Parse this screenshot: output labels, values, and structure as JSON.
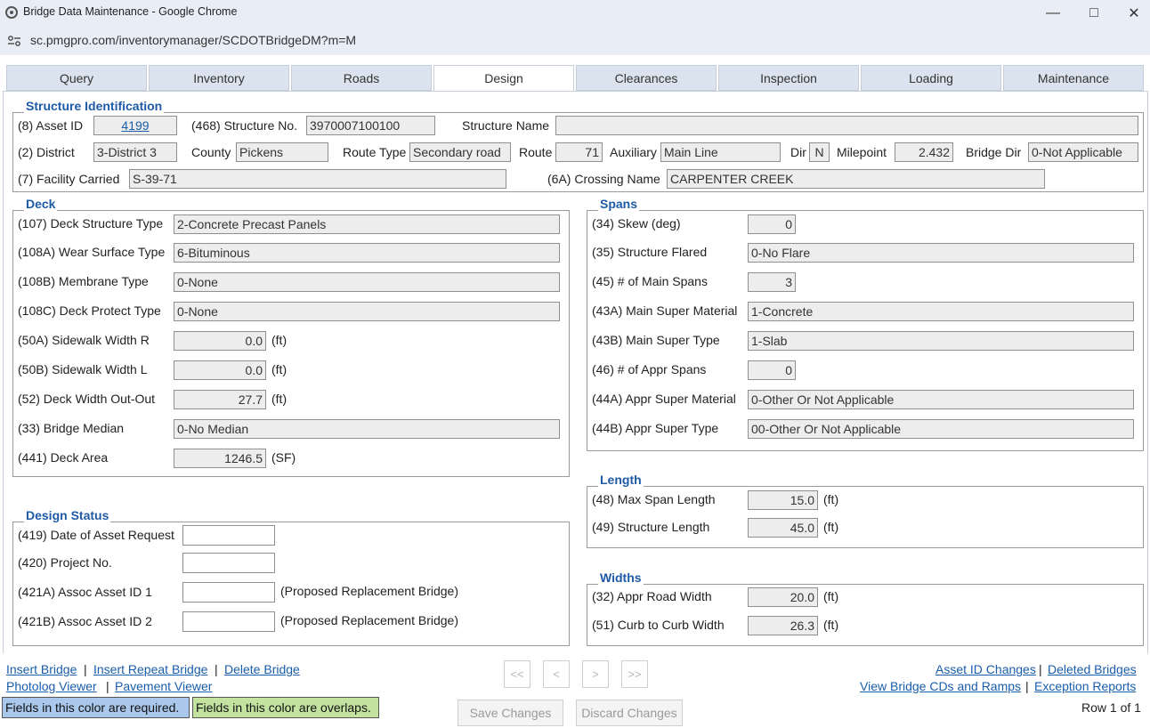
{
  "window": {
    "title": "Bridge Data Maintenance - Google Chrome",
    "url": "sc.pmgpro.com/inventorymanager/SCDOTBridgeDM?m=M"
  },
  "tabs": [
    "Query",
    "Inventory",
    "Roads",
    "Design",
    "Clearances",
    "Inspection",
    "Loading",
    "Maintenance"
  ],
  "active_tab": "Design",
  "structure_identification": {
    "legend": "Structure Identification",
    "asset_id_label": "(8) Asset ID",
    "asset_id": "4199",
    "structure_no_label": "(468) Structure No.",
    "structure_no": "3970007100100",
    "structure_name_label": "Structure Name",
    "structure_name": "",
    "district_label": "(2) District",
    "district": "3-District 3",
    "county_label": "County",
    "county": "Pickens",
    "route_type_label": "Route Type",
    "route_type": "Secondary road",
    "route_label": "Route",
    "route": "71",
    "auxiliary_label": "Auxiliary",
    "auxiliary": "Main Line",
    "dir_label": "Dir",
    "dir": "N",
    "milepoint_label": "Milepoint",
    "milepoint": "2.432",
    "bridge_dir_label": "Bridge Dir",
    "bridge_dir": "0-Not Applicable",
    "facility_label": "(7) Facility Carried",
    "facility": "S-39-71",
    "crossing_label": "(6A) Crossing Name",
    "crossing": "CARPENTER CREEK"
  },
  "deck": {
    "legend": "Deck",
    "rows": [
      {
        "label": "(107) Deck Structure Type",
        "value": "2-Concrete Precast Panels",
        "unit": ""
      },
      {
        "label": "(108A) Wear Surface Type",
        "value": "6-Bituminous",
        "unit": ""
      },
      {
        "label": "(108B) Membrane Type",
        "value": "0-None",
        "unit": ""
      },
      {
        "label": "(108C) Deck Protect Type",
        "value": "0-None",
        "unit": ""
      },
      {
        "label": "(50A) Sidewalk Width R",
        "value": "0.0",
        "unit": "(ft)"
      },
      {
        "label": "(50B) Sidewalk Width L",
        "value": "0.0",
        "unit": "(ft)"
      },
      {
        "label": "(52) Deck Width Out-Out",
        "value": "27.7",
        "unit": "(ft)"
      },
      {
        "label": "(33) Bridge Median",
        "value": "0-No Median",
        "unit": ""
      },
      {
        "label": "(441) Deck Area",
        "value": "1246.5",
        "unit": "(SF)"
      }
    ]
  },
  "spans": {
    "legend": "Spans",
    "rows": [
      {
        "label": "(34) Skew (deg)",
        "value": "0"
      },
      {
        "label": "(35) Structure Flared",
        "value": "0-No Flare"
      },
      {
        "label": "(45) # of Main Spans",
        "value": "3"
      },
      {
        "label": "(43A) Main Super Material",
        "value": "1-Concrete"
      },
      {
        "label": "(43B) Main Super Type",
        "value": "1-Slab"
      },
      {
        "label": "(46) # of Appr Spans",
        "value": "0"
      },
      {
        "label": "(44A) Appr Super Material",
        "value": "0-Other Or Not Applicable"
      },
      {
        "label": "(44B) Appr Super Type",
        "value": "00-Other Or Not Applicable"
      }
    ]
  },
  "length": {
    "legend": "Length",
    "rows": [
      {
        "label": "(48) Max Span Length",
        "value": "15.0",
        "unit": "(ft)"
      },
      {
        "label": "(49) Structure Length",
        "value": "45.0",
        "unit": "(ft)"
      }
    ]
  },
  "widths": {
    "legend": "Widths",
    "rows": [
      {
        "label": "(32) Appr Road Width",
        "value": "20.0",
        "unit": "(ft)"
      },
      {
        "label": "(51) Curb to Curb Width",
        "value": "26.3",
        "unit": "(ft)"
      }
    ]
  },
  "design_status": {
    "legend": "Design Status",
    "rows": [
      {
        "label": "(419) Date of Asset Request",
        "value": "",
        "note": ""
      },
      {
        "label": "(420) Project No.",
        "value": "",
        "note": ""
      },
      {
        "label": "(421A) Assoc Asset ID 1",
        "value": "",
        "note": "(Proposed Replacement Bridge)"
      },
      {
        "label": "(421B) Assoc Asset ID 2",
        "value": "",
        "note": "(Proposed Replacement Bridge)"
      }
    ]
  },
  "footer": {
    "insert_bridge": "Insert Bridge",
    "insert_repeat_bridge": "Insert Repeat Bridge",
    "delete_bridge": "Delete Bridge",
    "photolog_viewer": "Photolog Viewer",
    "pavement_viewer": "Pavement Viewer",
    "separator": "|",
    "nav_first": "<<",
    "nav_prev": "<",
    "nav_next": ">",
    "nav_last": ">>",
    "asset_id_changes": "Asset ID Changes",
    "deleted_bridges": "Deleted Bridges",
    "view_cds_ramps": "View Bridge CDs and Ramps",
    "exception_reports": "Exception Reports",
    "required_legend": "Fields in this color are required.",
    "overlap_legend": "Fields in this color are overlaps.",
    "save_changes": "Save Changes",
    "discard_changes": "Discard Changes",
    "row_status": "Row 1 of 1"
  },
  "colors": {
    "required": "#a9c8ec",
    "overlap": "#c4e3a1",
    "legend_text": "#1f5aa6",
    "link": "#1a5dab"
  }
}
